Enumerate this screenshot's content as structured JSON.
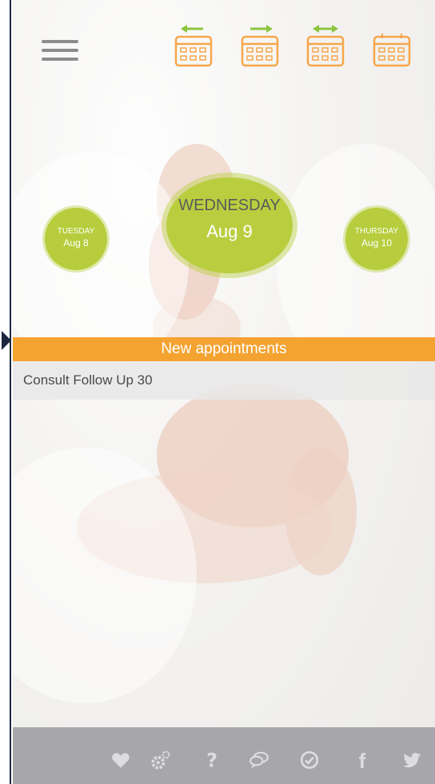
{
  "header": {
    "menu_icon": "hamburger-menu-icon",
    "calendar_buttons": [
      "calendar-previous-icon",
      "calendar-next-icon",
      "calendar-both-directions-icon",
      "calendar-icon"
    ]
  },
  "days": {
    "previous": {
      "weekday": "TUESDAY",
      "date": "Aug 8"
    },
    "current": {
      "weekday": "WEDNESDAY",
      "date": "Aug 9"
    },
    "next": {
      "weekday": "THURSDAY",
      "date": "Aug 10"
    }
  },
  "appointments": {
    "header": "New appointments",
    "items": [
      "Consult Follow Up 30"
    ]
  },
  "footer": {
    "icons": [
      "heart-icon",
      "gears-icon",
      "question-icon",
      "chat-icon",
      "check-circle-icon",
      "facebook-icon",
      "twitter-icon"
    ]
  },
  "colors": {
    "accent_green": "#b9ce3f",
    "accent_orange": "#f4a331",
    "footer_gray": "#a7a6aa",
    "calendar_orange": "#f6a64a",
    "calendar_arrow_green": "#8cc63f"
  }
}
